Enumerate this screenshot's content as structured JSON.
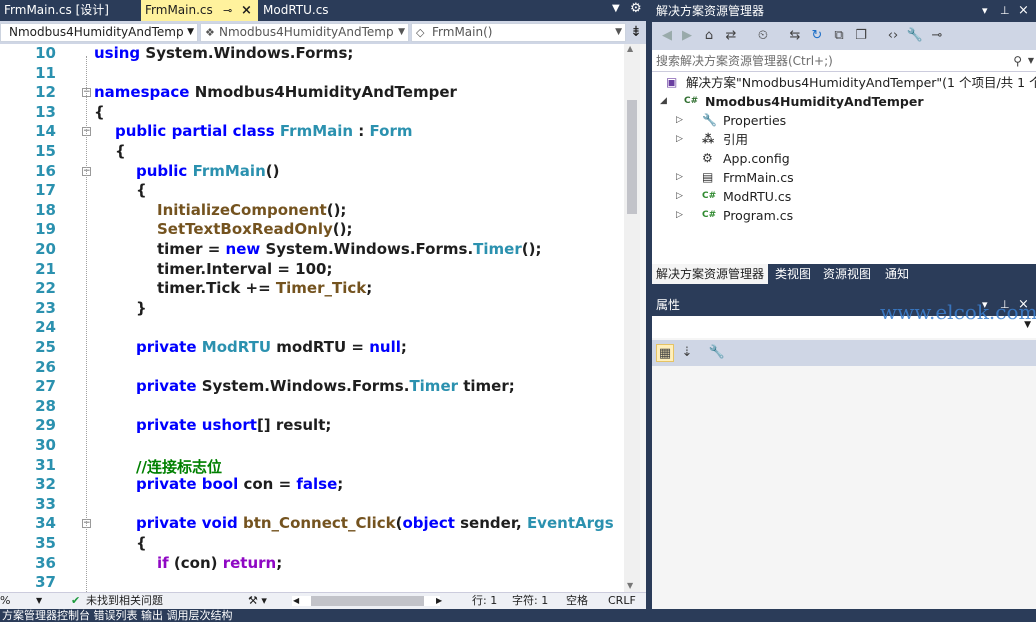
{
  "editor_tabs": [
    {
      "label": "FrmMain.cs [设计]",
      "active": false
    },
    {
      "label": "FrmMain.cs",
      "active": true
    },
    {
      "label": "ModRTU.cs",
      "active": false
    }
  ],
  "navbar": {
    "project": "Nmodbus4HumidityAndTemp",
    "class": "Nmodbus4HumidityAndTemp",
    "member": "FrmMain()"
  },
  "code_lines": [
    {
      "n": "10",
      "indent": 0,
      "segs": [
        [
          "pl",
          "    "
        ],
        [
          "kw",
          "using"
        ],
        [
          "pl",
          " System.Windows.Forms;"
        ]
      ]
    },
    {
      "n": "11",
      "indent": 0,
      "segs": []
    },
    {
      "n": "12",
      "indent": 0,
      "fold": true,
      "segs": [
        [
          "kw",
          "namespace"
        ],
        [
          "pl",
          " Nmodbus4HumidityAndTemper"
        ]
      ]
    },
    {
      "n": "13",
      "indent": 0,
      "segs": [
        [
          "pl",
          "{"
        ]
      ]
    },
    {
      "n": "14",
      "indent": 1,
      "fold": true,
      "segs": [
        [
          "kw",
          "public"
        ],
        [
          "pl",
          " "
        ],
        [
          "kw",
          "partial"
        ],
        [
          "pl",
          " "
        ],
        [
          "kw",
          "class"
        ],
        [
          "pl",
          " "
        ],
        [
          "ty",
          "FrmMain"
        ],
        [
          "pl",
          " : "
        ],
        [
          "ty",
          "Form"
        ]
      ]
    },
    {
      "n": "15",
      "indent": 1,
      "segs": [
        [
          "pl",
          "{"
        ]
      ]
    },
    {
      "n": "16",
      "indent": 2,
      "fold": true,
      "segs": [
        [
          "kw",
          "public"
        ],
        [
          "pl",
          " "
        ],
        [
          "ty",
          "FrmMain"
        ],
        [
          "pl",
          "()"
        ]
      ]
    },
    {
      "n": "17",
      "indent": 2,
      "segs": [
        [
          "pl",
          "{"
        ]
      ]
    },
    {
      "n": "18",
      "indent": 3,
      "segs": [
        [
          "fn",
          "InitializeComponent"
        ],
        [
          "pl",
          "();"
        ]
      ]
    },
    {
      "n": "19",
      "indent": 3,
      "segs": [
        [
          "fn",
          "SetTextBoxReadOnly"
        ],
        [
          "pl",
          "();"
        ]
      ]
    },
    {
      "n": "20",
      "indent": 3,
      "segs": [
        [
          "pl",
          "timer = "
        ],
        [
          "kw",
          "new"
        ],
        [
          "pl",
          " System.Windows.Forms."
        ],
        [
          "ty",
          "Timer"
        ],
        [
          "pl",
          "();"
        ]
      ]
    },
    {
      "n": "21",
      "indent": 3,
      "segs": [
        [
          "pl",
          "timer.Interval = 100;"
        ]
      ]
    },
    {
      "n": "22",
      "indent": 3,
      "segs": [
        [
          "pl",
          "timer.Tick += "
        ],
        [
          "fn",
          "Timer_Tick"
        ],
        [
          "pl",
          ";"
        ]
      ]
    },
    {
      "n": "23",
      "indent": 2,
      "segs": [
        [
          "pl",
          "}"
        ]
      ]
    },
    {
      "n": "24",
      "indent": 0,
      "segs": []
    },
    {
      "n": "25",
      "indent": 2,
      "segs": [
        [
          "kw",
          "private"
        ],
        [
          "pl",
          " "
        ],
        [
          "ty",
          "ModRTU"
        ],
        [
          "pl",
          " modRTU = "
        ],
        [
          "kw",
          "null"
        ],
        [
          "pl",
          ";"
        ]
      ]
    },
    {
      "n": "26",
      "indent": 0,
      "segs": []
    },
    {
      "n": "27",
      "indent": 2,
      "segs": [
        [
          "kw",
          "private"
        ],
        [
          "pl",
          " System.Windows.Forms."
        ],
        [
          "ty",
          "Timer"
        ],
        [
          "pl",
          " timer;"
        ]
      ]
    },
    {
      "n": "28",
      "indent": 0,
      "segs": []
    },
    {
      "n": "29",
      "indent": 2,
      "segs": [
        [
          "kw",
          "private"
        ],
        [
          "pl",
          " "
        ],
        [
          "kw",
          "ushort"
        ],
        [
          "pl",
          "[] result;"
        ]
      ]
    },
    {
      "n": "30",
      "indent": 0,
      "segs": []
    },
    {
      "n": "31",
      "indent": 2,
      "segs": [
        [
          "cm",
          "//连接标志位"
        ]
      ]
    },
    {
      "n": "32",
      "indent": 2,
      "segs": [
        [
          "kw",
          "private"
        ],
        [
          "pl",
          " "
        ],
        [
          "kw",
          "bool"
        ],
        [
          "pl",
          " con = "
        ],
        [
          "kw",
          "false"
        ],
        [
          "pl",
          ";"
        ]
      ]
    },
    {
      "n": "33",
      "indent": 0,
      "segs": []
    },
    {
      "n": "34",
      "indent": 2,
      "fold": true,
      "segs": [
        [
          "kw",
          "private"
        ],
        [
          "pl",
          " "
        ],
        [
          "kw",
          "void"
        ],
        [
          "pl",
          " "
        ],
        [
          "fn",
          "btn_Connect_Click"
        ],
        [
          "pl",
          "("
        ],
        [
          "kw",
          "object"
        ],
        [
          "pl",
          " sender, "
        ],
        [
          "ty",
          "EventArgs"
        ]
      ]
    },
    {
      "n": "35",
      "indent": 2,
      "segs": [
        [
          "pl",
          "{"
        ]
      ]
    },
    {
      "n": "36",
      "indent": 3,
      "segs": [
        [
          "purple",
          "if"
        ],
        [
          "pl",
          " (con) "
        ],
        [
          "purple",
          "return"
        ],
        [
          "pl",
          ";"
        ]
      ]
    },
    {
      "n": "37",
      "indent": 0,
      "segs": []
    }
  ],
  "status": {
    "zoom": "%",
    "issues": "未找到相关问题",
    "row": "行: 1",
    "col": "字符: 1",
    "spacing": "空格",
    "eol": "CRLF"
  },
  "bottom_strip": "方案管理器控制台  错误列表  输出  调用层次结构",
  "solution_explorer": {
    "title": "解决方案资源管理器",
    "search_placeholder": "搜索解决方案资源管理器(Ctrl+;)",
    "tree": [
      {
        "label": "解决方案\"Nmodbus4HumidityAndTemper\"(1 个项目/共 1 个)",
        "icon": "solution-icon",
        "level": 0,
        "exp": ""
      },
      {
        "label": "Nmodbus4HumidityAndTemper",
        "icon": "csharp-project-icon",
        "level": 1,
        "exp": "open",
        "bold": true
      },
      {
        "label": "Properties",
        "icon": "wrench-icon",
        "level": 2,
        "exp": "closed"
      },
      {
        "label": "引用",
        "icon": "references-icon",
        "level": 2,
        "exp": "closed"
      },
      {
        "label": "App.config",
        "icon": "config-file-icon",
        "level": 2,
        "exp": ""
      },
      {
        "label": "FrmMain.cs",
        "icon": "form-file-icon",
        "level": 2,
        "exp": "closed"
      },
      {
        "label": "ModRTU.cs",
        "icon": "csharp-file-icon",
        "level": 2,
        "exp": "closed"
      },
      {
        "label": "Program.cs",
        "icon": "csharp-file-icon",
        "level": 2,
        "exp": "closed"
      }
    ],
    "tabs": [
      "解决方案资源管理器",
      "类视图",
      "资源视图",
      "通知"
    ]
  },
  "properties": {
    "title": "属性"
  },
  "watermark": "www.elcok.com",
  "colors": {
    "chrome": "#2b3c59",
    "active_tab": "#fff29d",
    "keyword": "#0000ff",
    "type": "#2b91af",
    "method": "#74531f",
    "comment": "#008000",
    "control_keyword": "#8f08c4"
  }
}
